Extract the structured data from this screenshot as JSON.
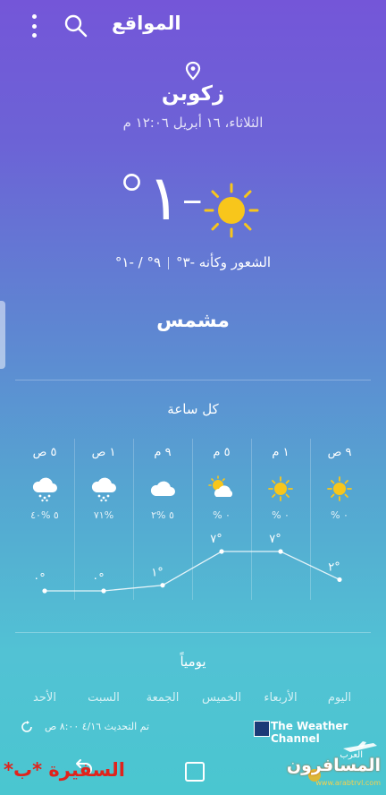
{
  "header": {
    "title": "المواقع"
  },
  "location": {
    "city": "زكوبن",
    "datetime": "الثلاثاء، ١٦ أبريل ١٢:٠٦ م"
  },
  "current": {
    "temperature": "-١°",
    "high_low": "٩° / -١°",
    "feels_like": "الشعور وكأنه -٣°",
    "condition": "مشمس",
    "icon": "sun-icon"
  },
  "hourly": {
    "title": "كل ساعة",
    "items": [
      {
        "time": "٩ ص",
        "icon": "sun-icon",
        "precip": "٠ %",
        "temp": "٢°",
        "temp_value": 2
      },
      {
        "time": "١ م",
        "icon": "sun-icon",
        "precip": "٠ %",
        "temp": "٧°",
        "temp_value": 7
      },
      {
        "time": "٥ م",
        "icon": "partly-cloudy-icon",
        "precip": "٠ %",
        "temp": "٧°",
        "temp_value": 7
      },
      {
        "time": "٩ م",
        "icon": "cloud-icon",
        "precip": "٥ %٢",
        "temp": "١°",
        "temp_value": 1
      },
      {
        "time": "١ ص",
        "icon": "snow-cloud-icon",
        "precip": "%٧١",
        "temp": "٠°",
        "temp_value": 0
      },
      {
        "time": "٥ ص",
        "icon": "snow-cloud-icon",
        "precip": "٥ %٤٠",
        "temp": "٠°",
        "temp_value": 0
      }
    ]
  },
  "daily": {
    "title": "يومياً",
    "days": [
      "اليوم",
      "الأربعاء",
      "الخميس",
      "الجمعة",
      "السبت",
      "الأحد"
    ]
  },
  "footer": {
    "updated": "تم التحديث ٤/١٦ ٨:٠٠ ص",
    "provider": "The Weather Channel"
  },
  "watermark": {
    "red_text": "السفيرة *ب*",
    "logo_small": "العرب",
    "logo_main": "المسافرون",
    "logo_url": "www.arabtrvl.com"
  },
  "colors": {
    "sun": "#f8c61b",
    "cloud": "#ffffff",
    "line": "#ffffff"
  }
}
